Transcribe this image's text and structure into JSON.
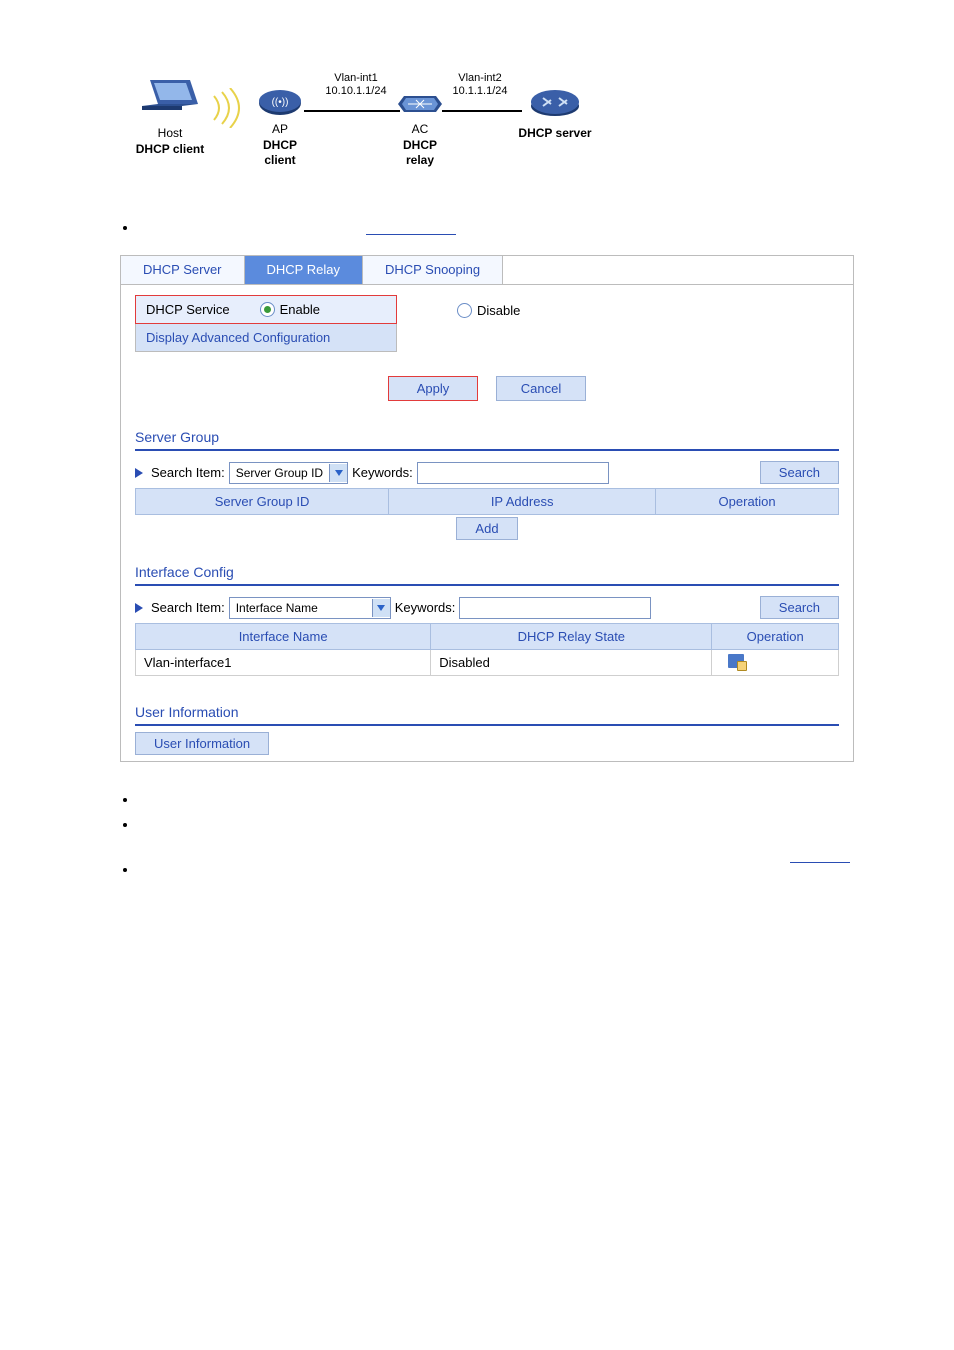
{
  "diagram": {
    "host_label1": "Host",
    "host_label2": "DHCP client",
    "ap_label1": "AP",
    "ap_label2": "DHCP client",
    "ac_label1": "AC",
    "ac_label2": "DHCP relay",
    "server_label": "DHCP server",
    "link1_label": "Vlan-int1\n10.10.1.1/24",
    "link2_label": "Vlan-int2\n10.1.1.1/24"
  },
  "tabs": {
    "server": "DHCP Server",
    "relay": "DHCP Relay",
    "snooping": "DHCP Snooping"
  },
  "service": {
    "label": "DHCP Service",
    "enable": "Enable",
    "disable": "Disable",
    "advanced": "Display Advanced Configuration",
    "apply": "Apply",
    "cancel": "Cancel"
  },
  "server_group": {
    "title": "Server Group",
    "search_item_label": "Search Item:",
    "search_item_value": "Server Group ID",
    "keywords_label": "Keywords:",
    "search_btn": "Search",
    "col_id": "Server Group ID",
    "col_ip": "IP Address",
    "col_op": "Operation",
    "add_btn": "Add"
  },
  "iface": {
    "title": "Interface Config",
    "search_item_label": "Search Item:",
    "search_item_value": "Interface Name",
    "keywords_label": "Keywords:",
    "search_btn": "Search",
    "col_name": "Interface Name",
    "col_state": "DHCP Relay State",
    "col_op": "Operation",
    "row_name": "Vlan-interface1",
    "row_state": "Disabled"
  },
  "userinfo": {
    "title": "User Information",
    "btn": "User Information"
  }
}
